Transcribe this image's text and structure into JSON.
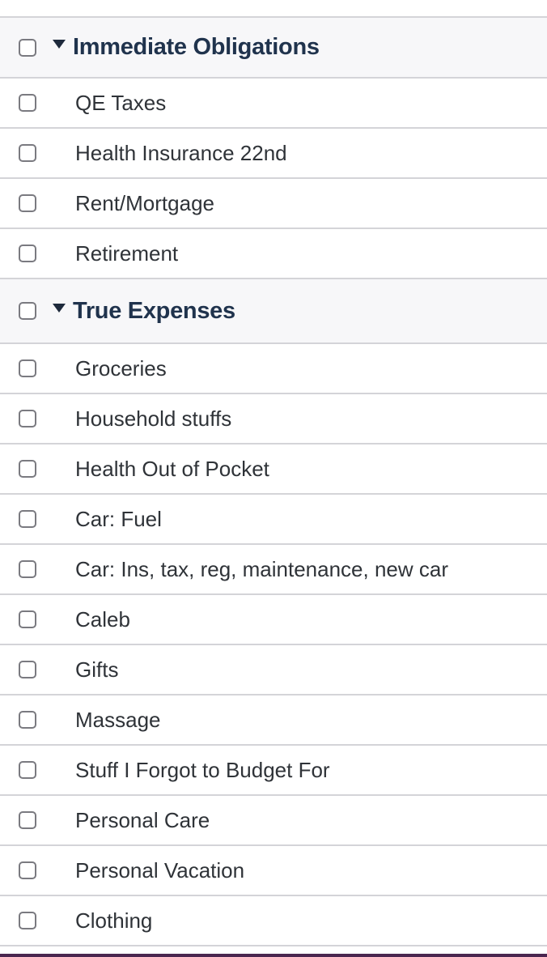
{
  "groups": [
    {
      "title": "Immediate Obligations",
      "expanded": true,
      "checked": false,
      "items": [
        {
          "label": "QE Taxes",
          "checked": false
        },
        {
          "label": "Health Insurance 22nd",
          "checked": false
        },
        {
          "label": "Rent/Mortgage",
          "checked": false
        },
        {
          "label": "Retirement",
          "checked": false
        }
      ]
    },
    {
      "title": "True Expenses",
      "expanded": true,
      "checked": false,
      "items": [
        {
          "label": "Groceries",
          "checked": false
        },
        {
          "label": "Household stuffs",
          "checked": false
        },
        {
          "label": "Health Out of Pocket",
          "checked": false
        },
        {
          "label": "Car: Fuel",
          "checked": false
        },
        {
          "label": "Car: Ins, tax, reg, maintenance, new car",
          "checked": false
        },
        {
          "label": "Caleb",
          "checked": false
        },
        {
          "label": "Gifts",
          "checked": false
        },
        {
          "label": "Massage",
          "checked": false
        },
        {
          "label": "Stuff I Forgot to Budget For",
          "checked": false
        },
        {
          "label": "Personal Care",
          "checked": false
        },
        {
          "label": "Personal Vacation",
          "checked": false
        },
        {
          "label": "Clothing",
          "checked": false
        }
      ]
    }
  ],
  "icons": {
    "checkbox": "checkbox-unchecked-icon",
    "caret": "caret-down-icon"
  },
  "colors": {
    "group_title": "#20334d",
    "group_bg": "#f7f7f9",
    "divider": "#d4d4d8",
    "bottom_bar": "#4a2650"
  }
}
